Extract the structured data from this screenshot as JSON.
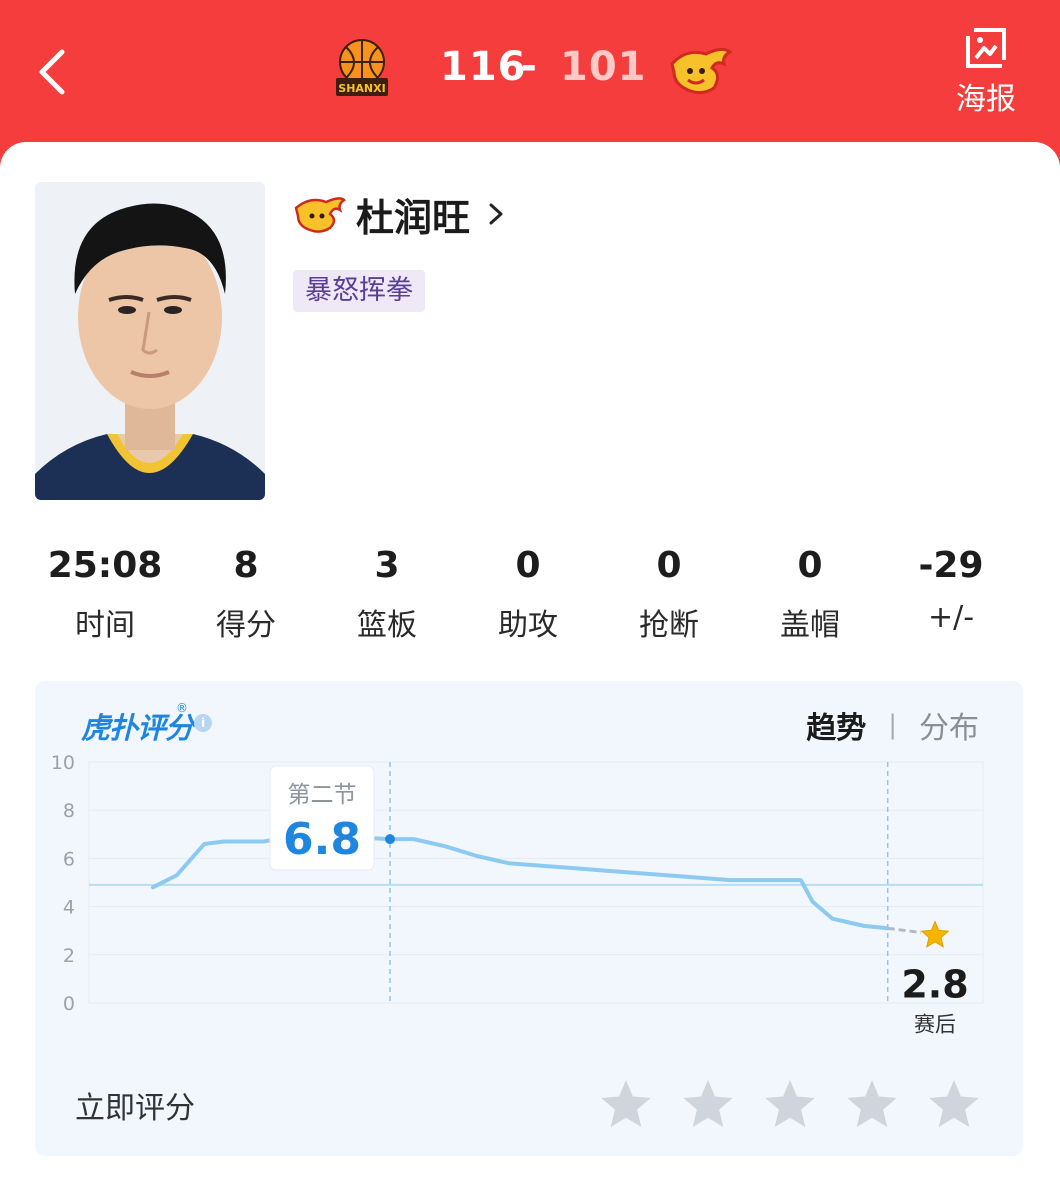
{
  "header": {
    "home_score": "116",
    "dash": "-",
    "away_score": "101",
    "home_logo_text": "SHANXI",
    "poster_label": "海报",
    "colors": {
      "bg": "#f43d3c",
      "home_score": "#ffffff",
      "away_score": "#ffc9c7"
    }
  },
  "player": {
    "name": "杜润旺",
    "tag": "暴怒挥拳"
  },
  "stats": [
    {
      "value": "25:08",
      "label": "时间"
    },
    {
      "value": "8",
      "label": "得分"
    },
    {
      "value": "3",
      "label": "篮板"
    },
    {
      "value": "0",
      "label": "助攻"
    },
    {
      "value": "0",
      "label": "抢断"
    },
    {
      "value": "0",
      "label": "盖帽"
    },
    {
      "value": "-29",
      "label": "+/-"
    }
  ],
  "rating": {
    "brand": "虎扑评分",
    "brand_mark": "®",
    "info_icon": "i",
    "tabs": [
      {
        "label": "趋势",
        "active": true
      },
      {
        "label": "分布",
        "active": false
      }
    ],
    "tab_separator": "|",
    "tooltip": {
      "period": "第二节",
      "value": "6.8"
    },
    "final": {
      "value": "2.8",
      "label": "赛后"
    },
    "rate_now_label": "立即评分",
    "star_count": 5,
    "colors": {
      "line": "#8ccaf2",
      "accent": "#1e86df",
      "star": "#f7b500",
      "empty_star": "#cfd5dc"
    }
  },
  "chart_data": {
    "type": "line",
    "yticks": [
      "10",
      "8",
      "6",
      "4",
      "2",
      "0"
    ],
    "ylim": [
      0,
      10
    ],
    "xlim": [
      0,
      100
    ],
    "reference_line": 4.9,
    "series": [
      {
        "x": [
          0,
          3,
          6.5,
          9,
          12,
          14,
          17,
          20,
          23,
          27,
          30,
          33,
          37,
          41,
          45,
          49,
          53,
          57,
          61,
          65,
          69,
          73,
          77,
          80,
          82,
          83.5,
          86,
          90,
          93
        ],
        "y": [
          4.8,
          5.3,
          6.6,
          6.7,
          6.7,
          6.7,
          6.9,
          7.0,
          6.9,
          6.85,
          6.8,
          6.8,
          6.5,
          6.1,
          5.8,
          5.7,
          5.6,
          5.5,
          5.4,
          5.3,
          5.2,
          5.1,
          5.1,
          5.1,
          5.1,
          4.2,
          3.5,
          3.2,
          3.1
        ]
      }
    ],
    "highlight": {
      "x": 30,
      "y": 6.8,
      "label": "第二节"
    },
    "final_point": {
      "x": 100,
      "y": 2.8,
      "label": "赛后"
    },
    "vertical_guides": [
      30,
      93
    ]
  }
}
